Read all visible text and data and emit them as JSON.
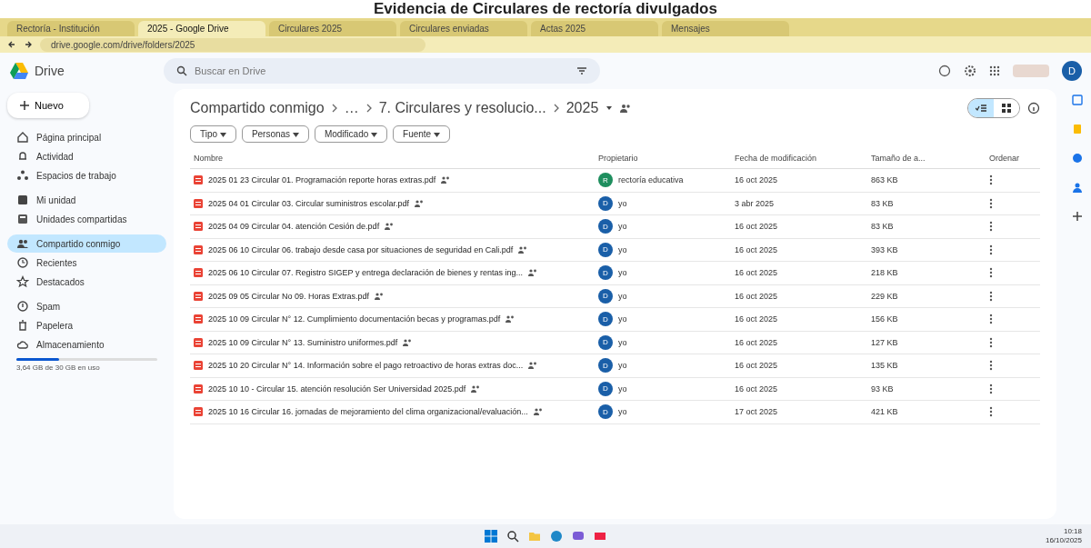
{
  "caption": "Evidencia de Circulares de rectoría divulgados",
  "browser": {
    "tabs": [
      {
        "label": "Rectoría - Institución",
        "selected": false
      },
      {
        "label": "2025 - Google Drive",
        "selected": true
      },
      {
        "label": "Circulares 2025",
        "selected": false
      },
      {
        "label": "Circulares enviadas",
        "selected": false
      },
      {
        "label": "Actas 2025",
        "selected": false
      },
      {
        "label": "Mensajes",
        "selected": false
      }
    ],
    "address": "drive.google.com/drive/folders/2025"
  },
  "app": {
    "name": "Drive",
    "search": {
      "placeholder": "Buscar en Drive"
    }
  },
  "sidebar": {
    "new_button": "Nuevo",
    "items": [
      {
        "label": "Página principal",
        "selected": false
      },
      {
        "label": "Actividad",
        "selected": false
      },
      {
        "label": "Espacios de trabajo",
        "selected": false
      },
      {
        "label": "Mi unidad",
        "selected": false
      },
      {
        "label": "Unidades compartidas",
        "selected": false
      },
      {
        "label": "Compartido conmigo",
        "selected": true
      },
      {
        "label": "Recientes",
        "selected": false
      },
      {
        "label": "Destacados",
        "selected": false
      },
      {
        "label": "Spam",
        "selected": false
      },
      {
        "label": "Papelera",
        "selected": false
      },
      {
        "label": "Almacenamiento",
        "selected": false
      }
    ],
    "storage": {
      "level": 0.3,
      "text": "3,64 GB de 30 GB en uso"
    }
  },
  "breadcrumb": [
    "Compartido conmigo",
    "…",
    "7. Circulares y resolucio...",
    "2025"
  ],
  "view_toggle": [
    {
      "kind": "list",
      "selected": true
    },
    {
      "kind": "grid",
      "selected": false
    }
  ],
  "filters": [
    "Tipo",
    "Personas",
    "Modificado",
    "Fuente"
  ],
  "table": {
    "columns": [
      "Nombre",
      "Propietario",
      "Fecha de modificación",
      "Tamaño de a...",
      "Ordenar"
    ],
    "rows": [
      {
        "name": "2025 01 23 Circular 01. Programación reporte horas extras.pdf",
        "owner": "rectoría educativa",
        "avatar": "R",
        "color": "#1e8e5e",
        "modified": "16 oct 2025",
        "size": "863 KB"
      },
      {
        "name": "2025 04 01 Circular 03. Circular suministros escolar.pdf",
        "owner": "yo",
        "avatar": "D",
        "color": "#1a5fa8",
        "modified": "3 abr 2025",
        "size": "83 KB"
      },
      {
        "name": "2025 04 09 Circular 04. atención Cesión de.pdf",
        "owner": "yo",
        "avatar": "D",
        "color": "#1a5fa8",
        "modified": "16 oct 2025",
        "size": "83 KB"
      },
      {
        "name": "2025 06 10 Circular 06. trabajo desde casa por situaciones de seguridad en Cali.pdf",
        "owner": "yo",
        "avatar": "D",
        "color": "#1a5fa8",
        "modified": "16 oct 2025",
        "size": "393 KB"
      },
      {
        "name": "2025 06 10 Circular 07. Registro SIGEP y entrega declaración de bienes y rentas ing...",
        "owner": "yo",
        "avatar": "D",
        "color": "#1a5fa8",
        "modified": "16 oct 2025",
        "size": "218 KB"
      },
      {
        "name": "2025 09 05 Circular No 09. Horas Extras.pdf",
        "owner": "yo",
        "avatar": "D",
        "color": "#1a5fa8",
        "modified": "16 oct 2025",
        "size": "229 KB"
      },
      {
        "name": "2025 10 09 Circular N° 12. Cumplimiento documentación becas y programas.pdf",
        "owner": "yo",
        "avatar": "D",
        "color": "#1a5fa8",
        "modified": "16 oct 2025",
        "size": "156 KB"
      },
      {
        "name": "2025 10 09 Circular N° 13. Suministro uniformes.pdf",
        "owner": "yo",
        "avatar": "D",
        "color": "#1a5fa8",
        "modified": "16 oct 2025",
        "size": "127 KB"
      },
      {
        "name": "2025 10 20 Circular N° 14. Información sobre el pago retroactivo de horas extras doc...",
        "owner": "yo",
        "avatar": "D",
        "color": "#1a5fa8",
        "modified": "16 oct 2025",
        "size": "135 KB"
      },
      {
        "name": "2025 10 10 - Circular 15. atención resolución Ser Universidad 2025.pdf",
        "owner": "yo",
        "avatar": "D",
        "color": "#1a5fa8",
        "modified": "16 oct 2025",
        "size": "93 KB"
      },
      {
        "name": "2025 10 16 Circular 16. jornadas de mejoramiento del clima organizacional/evaluación...",
        "owner": "yo",
        "avatar": "D",
        "color": "#1a5fa8",
        "modified": "17 oct 2025",
        "size": "421 KB"
      }
    ]
  },
  "account": {
    "avatar": "D"
  },
  "taskbar": {
    "time": "10:18",
    "date": "16/10/2025"
  }
}
